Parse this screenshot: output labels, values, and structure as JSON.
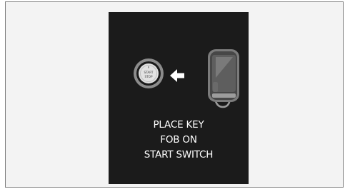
{
  "display": {
    "button_label_top": "START",
    "button_label_bottom": "STOP",
    "message_lines": [
      "PLACE KEY",
      "FOB ON",
      "START SWITCH"
    ]
  },
  "icons": {
    "button": "start-stop-button-icon",
    "arrow": "left-arrow-icon",
    "fob": "key-fob-icon"
  },
  "colors": {
    "frame_background": "#f3f3f3",
    "display_background": "#1b1b1b",
    "text": "#ffffff"
  }
}
